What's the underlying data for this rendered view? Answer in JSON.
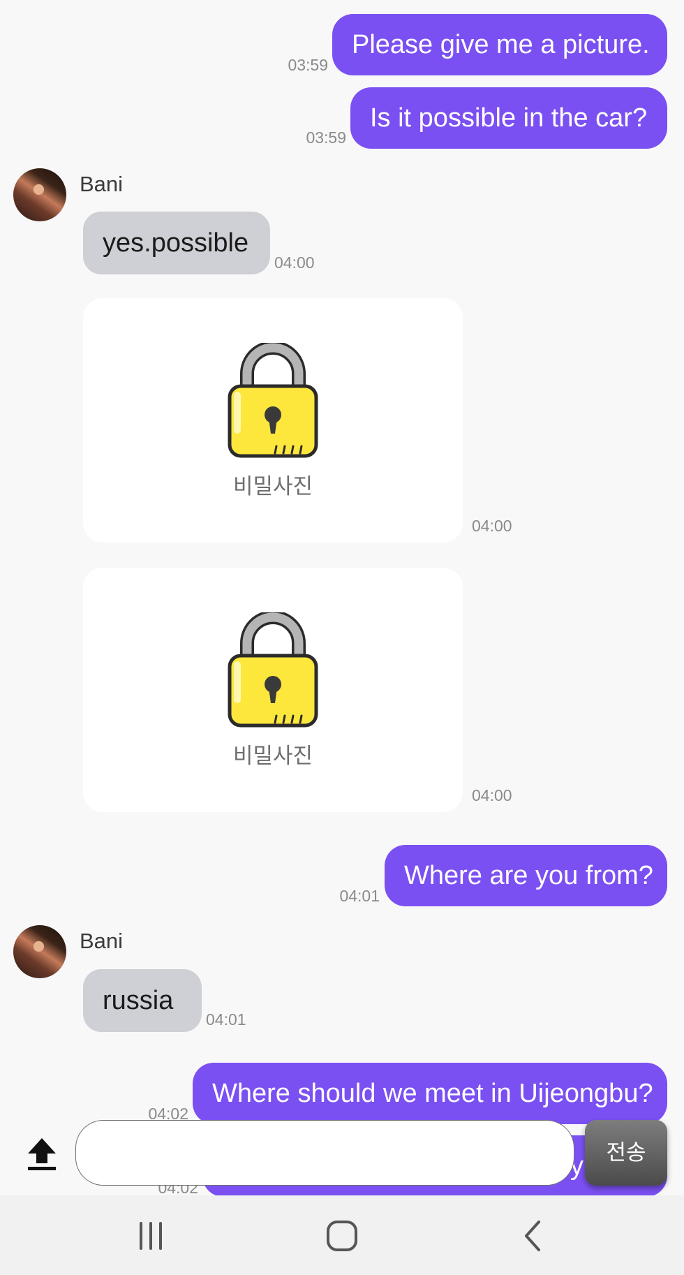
{
  "messages": {
    "m1": {
      "text": "Please give me a picture.",
      "time": "03:59"
    },
    "m2": {
      "text": "Is it possible in the car?",
      "time": "03:59"
    },
    "m3": {
      "sender": "Bani",
      "text": "yes.possible",
      "time": "04:00"
    },
    "m4": {
      "label": "비밀사진",
      "time": "04:00"
    },
    "m5": {
      "label": "비밀사진",
      "time": "04:00"
    },
    "m6": {
      "text": "Where are you from?",
      "time": "04:01"
    },
    "m7": {
      "sender": "Bani",
      "text": "russia",
      "time": "04:01"
    },
    "m8": {
      "text": "Where should we meet in Uijeongbu?",
      "time": "04:02"
    },
    "m9": {
      "text": "y",
      "time": "04:02"
    }
  },
  "composer": {
    "input_value": "",
    "send_label": "전송"
  },
  "colors": {
    "outgoing_bubble": "#7b50f2",
    "incoming_bubble": "#cfd0d5",
    "lock_body": "#fde73c"
  },
  "icons": {
    "upload": "upload-arrow-icon",
    "lock": "lock-icon",
    "recent_apps": "recent-apps-icon",
    "home": "home-icon",
    "back": "back-icon"
  }
}
